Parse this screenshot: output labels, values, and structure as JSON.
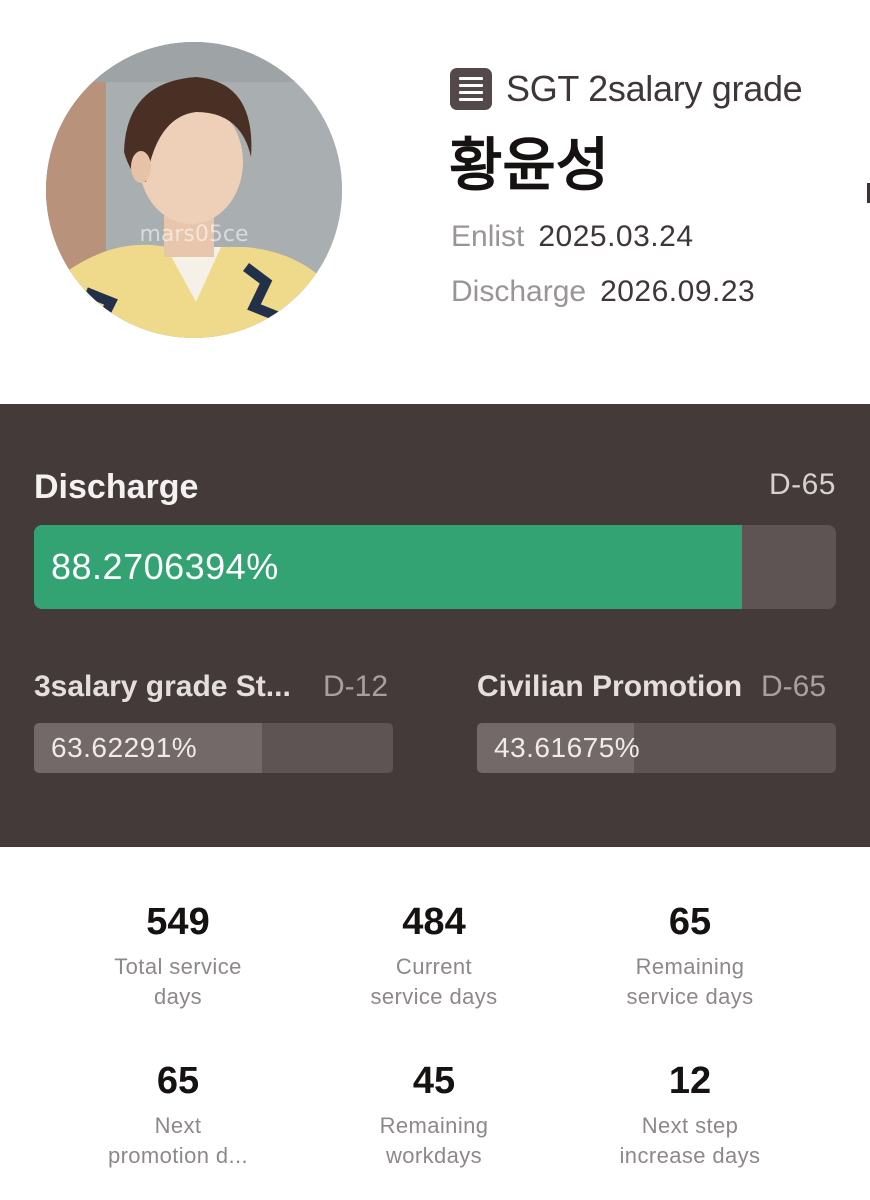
{
  "profile": {
    "avatar_watermark": "mars05ce",
    "rank_icon": "document-list-icon",
    "rank": "SGT 2salary grade",
    "name": "황윤성",
    "enlist_label": "Enlist",
    "enlist_date": "2025.03.24",
    "discharge_label": "Discharge",
    "discharge_date": "2026.09.23"
  },
  "progress": {
    "main": {
      "label": "Discharge",
      "dday": "D-65",
      "percent_text": "88.2706394%",
      "percent": 88.2706394,
      "color": "#34a373"
    },
    "secondary": [
      {
        "label": "3salary grade St...",
        "dday": "D-12",
        "percent_text": "63.62291%",
        "percent": 63.62291
      },
      {
        "label": "Civilian Promotion",
        "dday": "D-65",
        "percent_text": "43.61675%",
        "percent": 43.61675
      }
    ]
  },
  "stats": [
    {
      "value": "549",
      "caption_line1": "Total service",
      "caption_line2": "days"
    },
    {
      "value": "484",
      "caption_line1": "Current",
      "caption_line2": "service days"
    },
    {
      "value": "65",
      "caption_line1": "Remaining",
      "caption_line2": "service days"
    },
    {
      "value": "65",
      "caption_line1": "Next",
      "caption_line2": "promotion d..."
    },
    {
      "value": "45",
      "caption_line1": "Remaining",
      "caption_line2": "workdays"
    },
    {
      "value": "12",
      "caption_line1": "Next step",
      "caption_line2": "increase days"
    }
  ],
  "colors": {
    "panel_bg": "#433a39",
    "progress_green": "#34a373",
    "track": "#5d5453"
  }
}
